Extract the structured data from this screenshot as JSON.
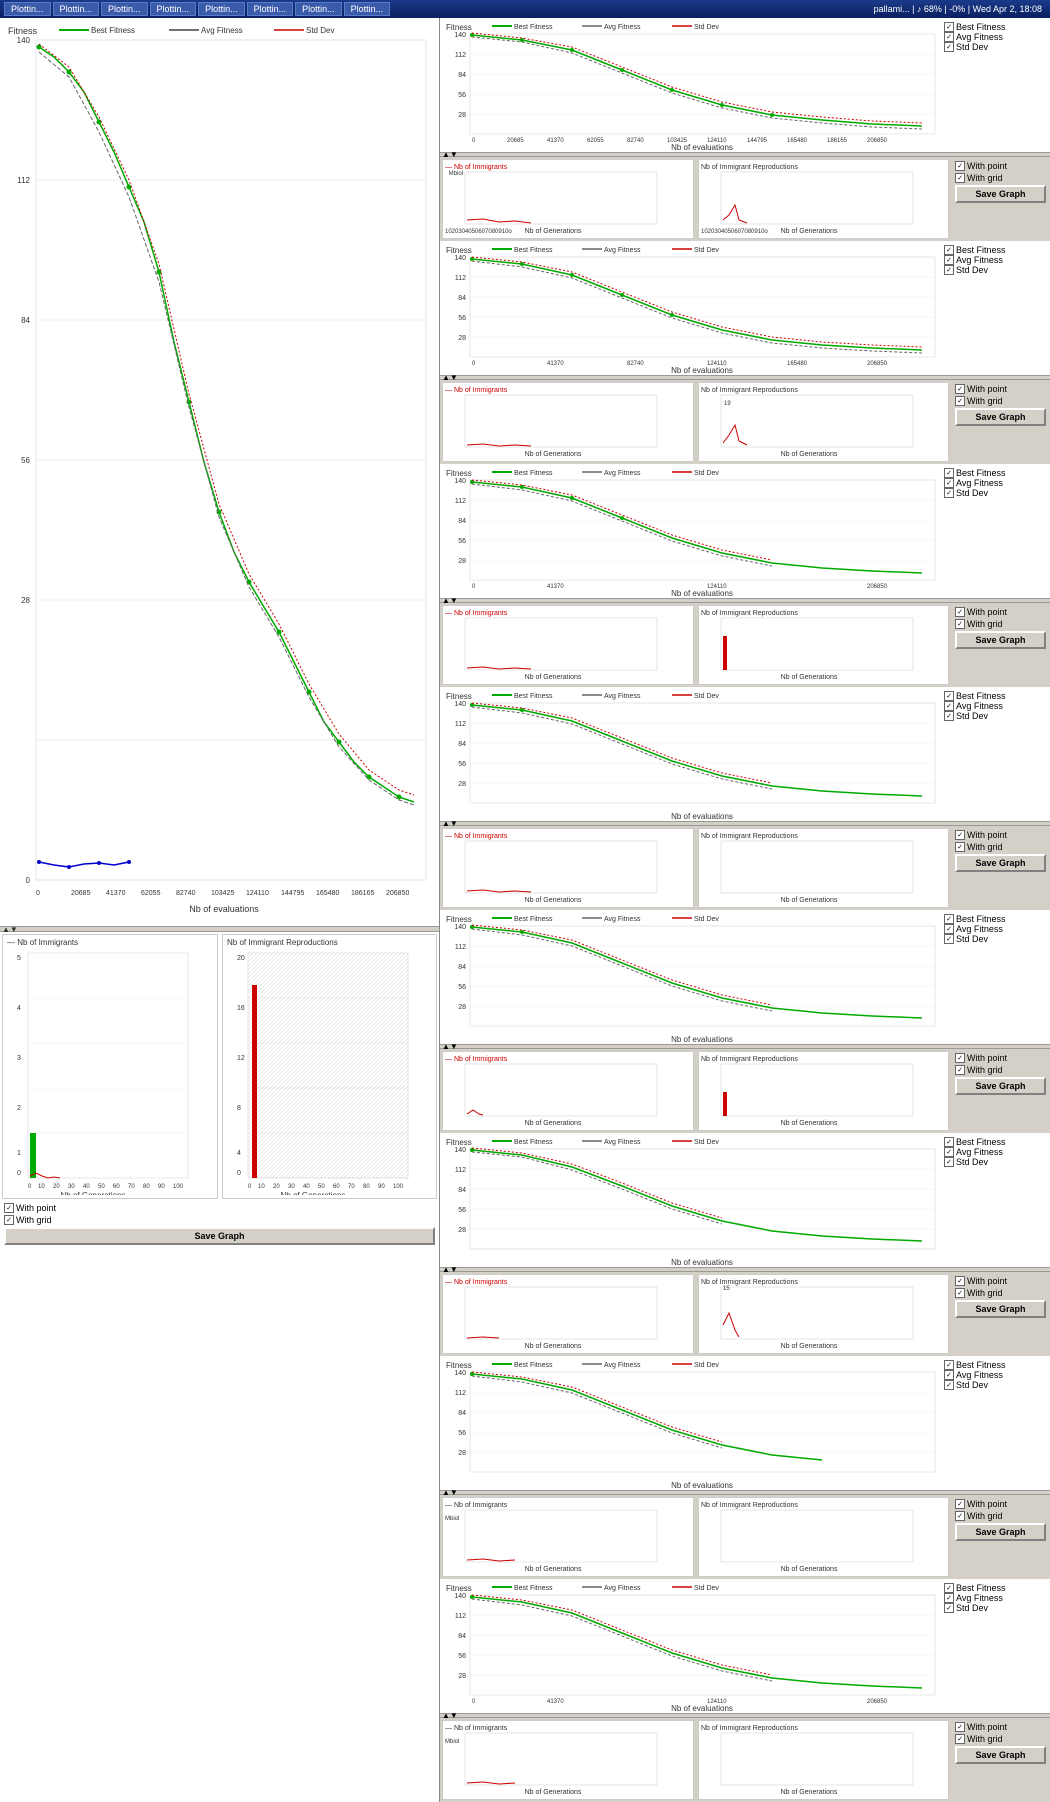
{
  "taskbar": {
    "items": [
      "Plottin...",
      "Plottin...",
      "Plottin...",
      "Plottin...",
      "Plottin...",
      "Plottin...",
      "Plottin...",
      "Plottin..."
    ],
    "user": "pallami...",
    "music": "♪ 68% | -0%",
    "clock": "Wed Apr 2, 18:08"
  },
  "left_panel": {
    "big_graph": {
      "title": "Fitness",
      "y_ticks": [
        "140",
        "112",
        "84",
        "56",
        "28",
        "0"
      ],
      "x_ticks": [
        "0",
        "20685",
        "41370",
        "62055",
        "82740",
        "103425",
        "124110",
        "144795",
        "165480",
        "186165",
        "206850"
      ],
      "x_label": "Nb of evaluations"
    },
    "bottom_graphs": {
      "left": {
        "title": "Nb of Immigrants",
        "y_ticks": [
          "5",
          "4",
          "3",
          "2",
          "1",
          "0"
        ],
        "x_ticks": [
          "0",
          "10",
          "20",
          "30",
          "40",
          "50",
          "60",
          "70",
          "80",
          "90",
          "100"
        ],
        "x_label": "Nb of Generations"
      },
      "right": {
        "title": "Nb of Immigrant Reproductions",
        "y_ticks": [
          "20",
          "16",
          "12",
          "8",
          "4",
          "0"
        ],
        "x_ticks": [
          "0",
          "10",
          "20",
          "30",
          "40",
          "50",
          "60",
          "70",
          "80",
          "90",
          "100"
        ],
        "x_label": "Nb of Generations"
      }
    },
    "bottom_controls": {
      "with_point_checked": true,
      "with_grid_checked": true,
      "with_point_label": "With point",
      "with_grid_label": "With grid",
      "save_label": "Save Graph"
    }
  },
  "legend": {
    "best_fitness": {
      "label": "Best Fitness",
      "color": "#00aa00"
    },
    "avg_fitness": {
      "label": "Avg Fitness",
      "color": "#444444"
    },
    "std_dev": {
      "label": "Std Dev",
      "color": "#cc0000"
    }
  },
  "right_panel": {
    "rows": [
      {
        "fitness": {
          "title": "Fitness",
          "best": true,
          "avg": true,
          "std": true
        },
        "immigration": {
          "nb_immigrants_title": "Nb of Immigrants",
          "nb_reproductions_title": "Nb of Immigrant Reproductions",
          "with_point": true,
          "with_grid": true
        }
      },
      {
        "fitness": {
          "title": "Fitness",
          "best": true,
          "avg": true,
          "std": true
        },
        "immigration": {
          "nb_immigrants_title": "Nb of Immigrants",
          "nb_reproductions_title": "Nb of Immigrant Reproductions",
          "with_point": true,
          "with_grid": true
        }
      },
      {
        "fitness": {
          "title": "Fitness",
          "best": true,
          "avg": true,
          "std": true
        },
        "immigration": {
          "nb_immigrants_title": "Nb of Immigrants",
          "nb_reproductions_title": "Nb of Immigrant Reproductions",
          "with_point": true,
          "with_grid": true
        }
      },
      {
        "fitness": {
          "title": "Fitness",
          "best": true,
          "avg": true,
          "std": true
        },
        "immigration": {
          "nb_immigrants_title": "Nb of Immigrants",
          "nb_reproductions_title": "Nb of Immigrant Reproductions",
          "with_point": true,
          "with_grid": true
        }
      },
      {
        "fitness": {
          "title": "Fitness",
          "best": true,
          "avg": true,
          "std": true
        },
        "immigration": {
          "nb_immigrants_title": "Nb of Immigrants",
          "nb_reproductions_title": "Nb of Immigrant Reproductions",
          "with_point": true,
          "with_grid": true
        }
      },
      {
        "fitness": {
          "title": "Fitness",
          "best": true,
          "avg": true,
          "std": true
        },
        "immigration": {
          "nb_immigrants_title": "Nb of Immigrants",
          "nb_reproductions_title": "Nb of Immigrant Reproductions",
          "with_point": true,
          "with_grid": true
        }
      },
      {
        "fitness": {
          "title": "Fitness",
          "best": true,
          "avg": true,
          "std": true
        },
        "immigration": {
          "nb_immigrants_title": "Nb of Immigrants",
          "nb_reproductions_title": "Nb of Immigrant Reproductions",
          "with_point": true,
          "with_grid": true
        }
      },
      {
        "fitness": {
          "title": "Fitness",
          "best": true,
          "avg": true,
          "std": true
        },
        "immigration": {
          "nb_immigrants_title": "Nb of Immigrants",
          "nb_reproductions_title": "Nb of Immigrant Reproductions",
          "with_point": true,
          "with_grid": true
        }
      }
    ],
    "labels": {
      "best_fitness": "Best Fitness",
      "avg_fitness": "Avg Fitness",
      "std_dev": "Std Dev",
      "with_point": "With point",
      "with_grid": "With grid",
      "save_graph": "Save Graph",
      "nb_evaluations": "Nb of evaluations",
      "nb_generations": "Nb of Generations"
    },
    "x_ticks": [
      "0",
      "20685",
      "41370",
      "62055",
      "82740103425124110144795165480186165206850"
    ],
    "gen_ticks": "1020304050607080910o"
  }
}
